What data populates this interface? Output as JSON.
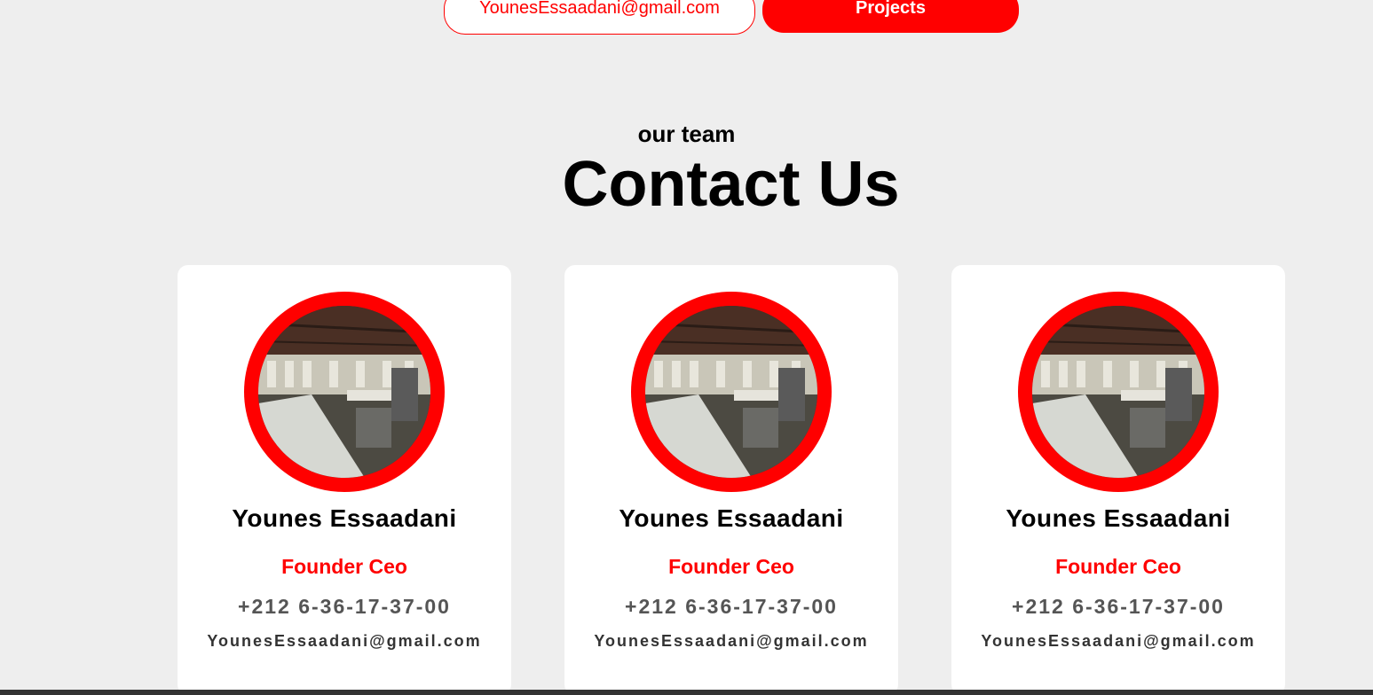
{
  "top_buttons": {
    "email_label": "YounesEssaadani@gmail.com",
    "projects_label": "Projects"
  },
  "section": {
    "subtitle": "our team",
    "title": "Contact Us"
  },
  "team": [
    {
      "name": "Younes Essaadani",
      "role": "Founder Ceo",
      "phone": "+212 6-36-17-37-00",
      "email": "YounesEssaadani@gmail.com"
    },
    {
      "name": "Younes Essaadani",
      "role": "Founder Ceo",
      "phone": "+212 6-36-17-37-00",
      "email": "YounesEssaadani@gmail.com"
    },
    {
      "name": "Younes Essaadani",
      "role": "Founder Ceo",
      "phone": "+212 6-36-17-37-00",
      "email": "YounesEssaadani@gmail.com"
    }
  ],
  "colors": {
    "accent": "#ff0000",
    "background": "#eeeeee",
    "card": "#ffffff"
  }
}
